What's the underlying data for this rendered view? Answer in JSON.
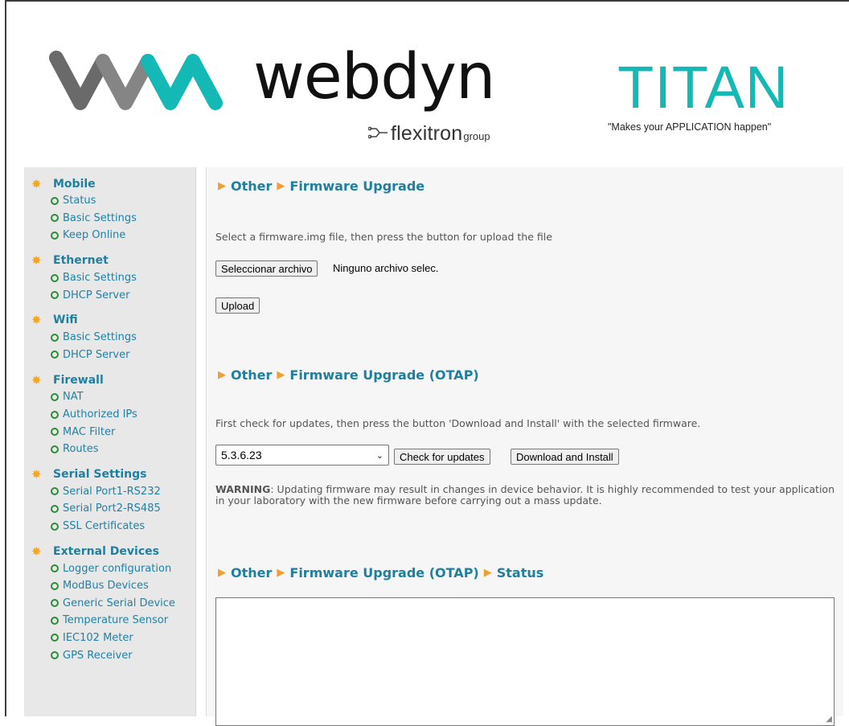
{
  "header": {
    "brand_word": "webdyn",
    "flex_main": "flexitron",
    "flex_sub": "group",
    "titan_title": "TITAN",
    "titan_tagline": "\"Makes your APPLICATION happen\""
  },
  "colors": {
    "teal": "#14b8b5",
    "link_blue": "#2080a6",
    "heading_blue": "#1f7f9f",
    "orange": "#f0a030",
    "star": "#f5a623",
    "bullet_green": "#2e8b3a"
  },
  "sidebar": {
    "groups": [
      {
        "title": "Mobile",
        "items": [
          "Status",
          "Basic Settings",
          "Keep Online"
        ]
      },
      {
        "title": "Ethernet",
        "items": [
          "Basic Settings",
          "DHCP Server"
        ]
      },
      {
        "title": "Wifi",
        "items": [
          "Basic Settings",
          "DHCP Server"
        ]
      },
      {
        "title": "Firewall",
        "items": [
          "NAT",
          "Authorized IPs",
          "MAC Filter",
          "Routes"
        ]
      },
      {
        "title": "Serial Settings",
        "items": [
          "Serial Port1-RS232",
          "Serial Port2-RS485",
          "SSL Certificates"
        ]
      },
      {
        "title": "External Devices",
        "items": [
          "Logger configuration",
          "ModBus Devices",
          "Generic Serial Device",
          "Temperature Sensor",
          "IEC102 Meter",
          "GPS Receiver"
        ]
      }
    ]
  },
  "upgrade": {
    "crumb1": "Other",
    "crumb2": "Firmware Upgrade",
    "desc": "Select a firmware.img file, then press the button for upload the file",
    "choose_file": "Seleccionar archivo",
    "no_file": "Ninguno archivo selec.",
    "upload": "Upload"
  },
  "otap": {
    "crumb1": "Other",
    "crumb2": "Firmware Upgrade (OTAP)",
    "desc": "First check for updates, then press the button 'Download and Install' with the selected firmware.",
    "selected_version": "5.3.6.23",
    "check": "Check for updates",
    "download": "Download and Install",
    "warning_label": "WARNING",
    "warning_text": ": Updating firmware may result in changes in device behavior. It is highly recommended to test your application in your laboratory with the new firmware before carrying out a mass update."
  },
  "status": {
    "crumb1": "Other",
    "crumb2": "Firmware Upgrade (OTAP)",
    "crumb3": "Status"
  }
}
